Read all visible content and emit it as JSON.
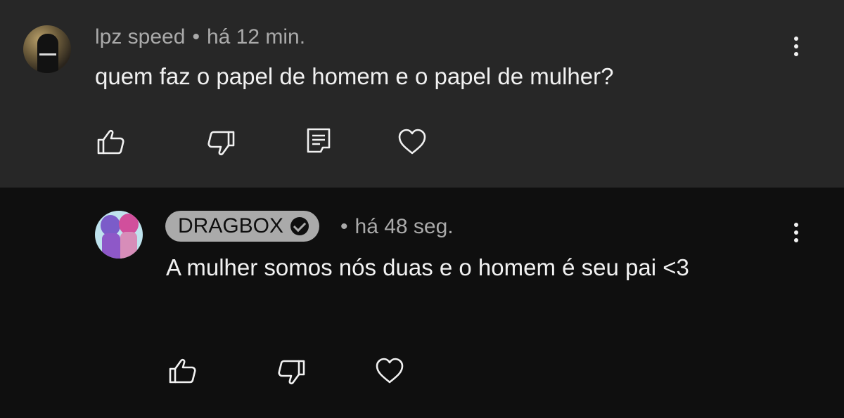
{
  "comment": {
    "author": "lpz speed",
    "separator": "•",
    "time": "há 12 min.",
    "text": "quem faz o papel de homem e o papel de mulher?",
    "avatar_icon": "user-avatar-photo",
    "menu_icon": "more-vertical-icon",
    "actions": [
      "like-icon",
      "dislike-icon",
      "reply-icon",
      "heart-icon"
    ]
  },
  "reply": {
    "author": "DRAGBOX",
    "verified_icon": "verified-check-icon",
    "separator": "•",
    "time": "há 48 seg.",
    "text": "A mulher somos nós duas e o homem é seu pai <3",
    "avatar_icon": "channel-avatar-photo",
    "menu_icon": "more-vertical-icon",
    "actions": [
      "like-icon",
      "dislike-icon",
      "heart-icon"
    ]
  },
  "colors": {
    "top_background": "#272727",
    "reply_background": "#0f0f0f",
    "text_primary": "#f1f1f1",
    "text_secondary": "#aaaaaa"
  }
}
